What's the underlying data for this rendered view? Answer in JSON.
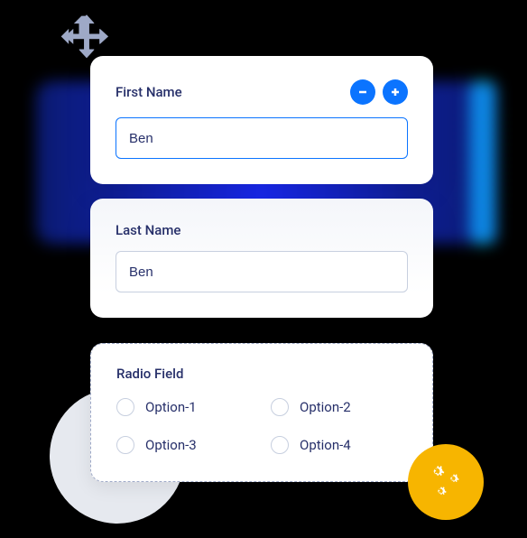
{
  "card1": {
    "label": "First Name",
    "value": "Ben"
  },
  "card2": {
    "label": "Last Name",
    "value": "Ben"
  },
  "card3": {
    "label": "Radio Field",
    "options": {
      "0": "Option-1",
      "1": "Option-2",
      "2": "Option-3",
      "3": "Option-4"
    }
  },
  "colors": {
    "accent": "#0b74ff",
    "yellow": "#f7b500"
  }
}
